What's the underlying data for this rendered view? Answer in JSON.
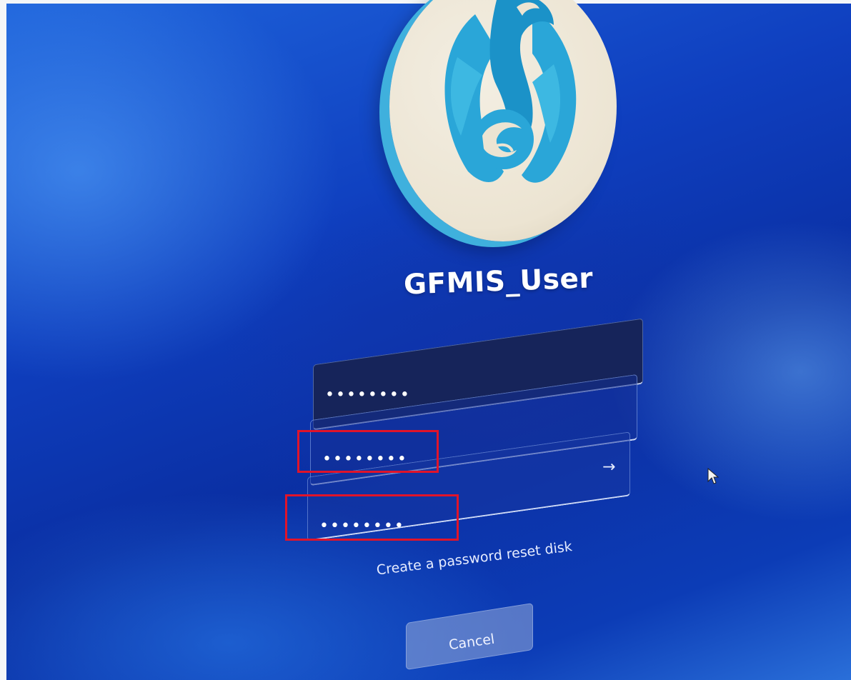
{
  "account": {
    "username": "GFMIS_User"
  },
  "password_fields": [
    {
      "masked_value": "••••••••"
    },
    {
      "masked_value": "••••••••"
    },
    {
      "masked_value": "••••••••"
    }
  ],
  "submit_icon": "arrow-right-icon",
  "links": {
    "reset_disk": "Create a password reset disk"
  },
  "buttons": {
    "cancel": "Cancel"
  },
  "colors": {
    "background": "#0f3fbf",
    "highlight": "#e0142a",
    "logo_accent": "#3fb0dd",
    "logo_bg": "#ece4d2"
  }
}
